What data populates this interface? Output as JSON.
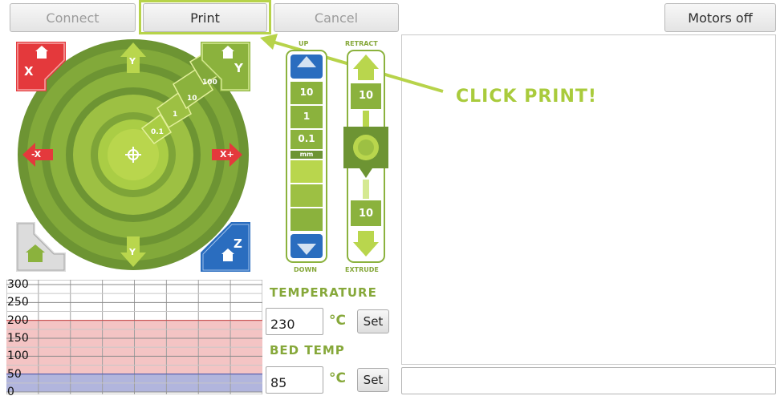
{
  "toolbar": {
    "connect_label": "Connect",
    "print_label": "Print",
    "cancel_label": "Cancel",
    "motors_off_label": "Motors off"
  },
  "annotation": {
    "text": "CLICK PRINT!",
    "color": "#a9cb3c"
  },
  "xy_jog": {
    "step_labels": [
      "0.1",
      "1",
      "10",
      "100"
    ],
    "axis_labels": {
      "x_minus": "-X",
      "x_plus": "X+",
      "y_top": "Y",
      "y_bottom": "Y",
      "z": "Z",
      "home_x": "X",
      "home_y": "Y"
    }
  },
  "z_jog": {
    "up_label": "UP",
    "down_label": "DOWN",
    "steps": [
      "10",
      "1",
      "0.1"
    ],
    "unit": "mm"
  },
  "extruder": {
    "retract_label": "RETRACT",
    "extrude_label": "EXTRUDE",
    "retract_amount": "10",
    "extrude_amount": "10"
  },
  "temperature": {
    "heading": "TEMPERATURE",
    "value": "230",
    "unit": "°C",
    "set_label": "Set"
  },
  "bed_temp": {
    "heading": "BED TEMP",
    "value": "85",
    "unit": "°C",
    "set_label": "Set"
  },
  "graph": {
    "y_labels": [
      "300",
      "250",
      "200",
      "150",
      "100",
      "50",
      "0"
    ],
    "ymax": 300,
    "hotend_target": 200,
    "bed_target": 50,
    "hotend_color": "#f4c4c4",
    "bed_color": "#b1b5dd"
  },
  "colors": {
    "green_dark": "#6d9433",
    "green_mid": "#8bb23d",
    "green_light": "#b7d34a",
    "red": "#e4393c",
    "blue": "#2a6dbf"
  }
}
